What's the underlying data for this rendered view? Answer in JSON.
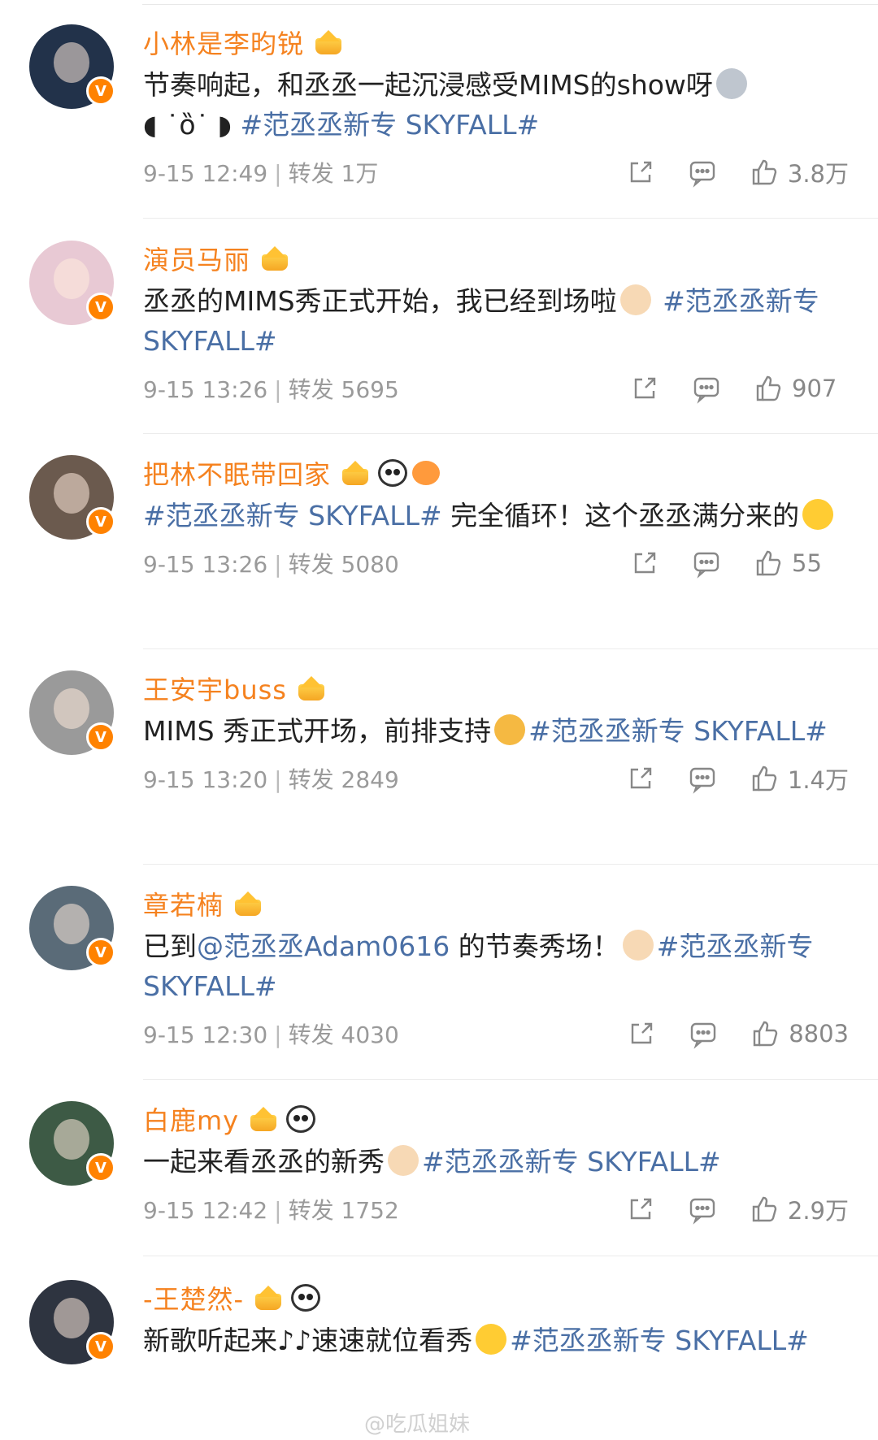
{
  "posts": [
    {
      "username": "小林是李昀锐",
      "text_before": "节奏响起，和丞丞一起沉浸感受MIMS的show呀",
      "text_extra": "◖ ˙ȍ˙ ◗",
      "hashtag": "#范丞丞新专 SKYFALL#",
      "text_after": "",
      "time": "9-15 12:49",
      "repost_label": "转发",
      "repost_count": "1万",
      "likes": "3.8万",
      "avatar_color": "#22324a",
      "badges": [
        "crown-icon"
      ]
    },
    {
      "username": "演员马丽",
      "text_before": "丞丞的MIMS秀正式开始，我已经到场啦",
      "text_extra": "",
      "hashtag": "#范丞丞新专 SKYFALL#",
      "text_after": "",
      "time": "9-15 13:26",
      "repost_label": "转发",
      "repost_count": "5695",
      "likes": "907",
      "avatar_color": "#e8c9d4",
      "badges": [
        "crown-icon"
      ]
    },
    {
      "username": "把林不眠带回家",
      "text_before": "",
      "text_extra": "",
      "hashtag": "#范丞丞新专 SKYFALL#",
      "text_after": " 完全循环！这个丞丞满分来的",
      "time": "9-15 13:26",
      "repost_label": "转发",
      "repost_count": "5080",
      "likes": "55",
      "avatar_color": "#6b5a4e",
      "badges": [
        "crown-icon",
        "panda-icon",
        "pufferfish-icon"
      ]
    },
    {
      "username": "王安宇buss",
      "text_before": "MIMS 秀正式开场，前排支持",
      "text_extra": "",
      "hashtag": "#范丞丞新专 SKYFALL#",
      "text_after": "",
      "time": "9-15 13:20",
      "repost_label": "转发",
      "repost_count": "2849",
      "likes": "1.4万",
      "avatar_color": "#9a9a9a",
      "badges": [
        "crown-icon"
      ]
    },
    {
      "username": "章若楠",
      "text_before": "已到",
      "mention": "@范丞丞Adam0616",
      "text_mid": " 的节奏秀场！",
      "text_extra": "",
      "hashtag": "#范丞丞新专 SKYFALL#",
      "text_after": "",
      "time": "9-15 12:30",
      "repost_label": "转发",
      "repost_count": "4030",
      "likes": "8803",
      "avatar_color": "#5a6b78",
      "badges": [
        "crown-icon"
      ]
    },
    {
      "username": "白鹿my",
      "text_before": "一起来看丞丞的新秀",
      "text_extra": "",
      "hashtag": "#范丞丞新专 SKYFALL#",
      "text_after": "",
      "time": "9-15 12:42",
      "repost_label": "转发",
      "repost_count": "1752",
      "likes": "2.9万",
      "avatar_color": "#3d5a45",
      "badges": [
        "crown-icon",
        "panda-icon"
      ]
    },
    {
      "username": "-王楚然-",
      "text_before": "新歌听起来",
      "text_extra": "♪♪",
      "text_mid": "速速就位看秀",
      "hashtag": "#范丞丞新专 SKYFALL#",
      "text_after": "",
      "time": "",
      "repost_label": "",
      "repost_count": "",
      "likes": "",
      "avatar_color": "#2e3440",
      "badges": [
        "crown-icon",
        "panda-icon"
      ]
    }
  ],
  "watermark": "@吃瓜姐妹",
  "colors": {
    "username": "#f5821f",
    "hashtag": "#4a6fa5",
    "meta": "#9a9a9a",
    "badge": "#ff8200"
  }
}
